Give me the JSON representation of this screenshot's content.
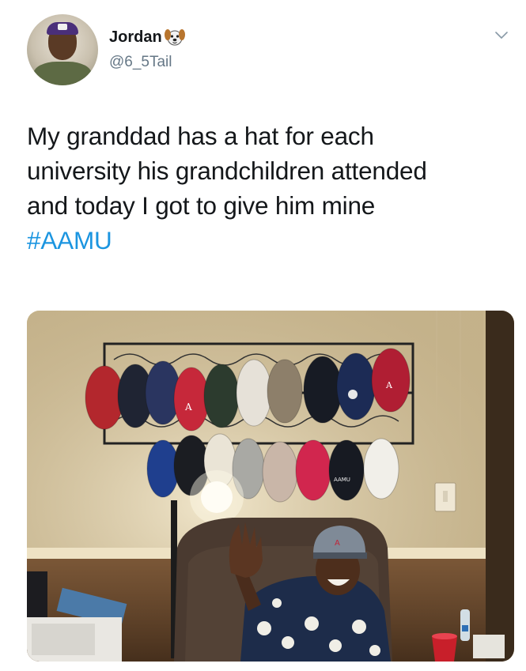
{
  "user": {
    "display_name": "Jordan",
    "emoji_icon": "dog-face-emoji",
    "handle": "@6_5Tail"
  },
  "menu": {
    "icon": "chevron-down-icon"
  },
  "tweet": {
    "lines": [
      "My granddad has a hat for each",
      "university his grandchildren attended",
      "and today I got to give him mine"
    ],
    "hashtag": "#AAMU"
  },
  "photo": {
    "icon": "photo-image",
    "cap_labels": [
      "A",
      "A",
      "AAMU"
    ]
  },
  "colors": {
    "text": "#14171a",
    "secondary": "#657786",
    "link": "#1b95e0"
  }
}
